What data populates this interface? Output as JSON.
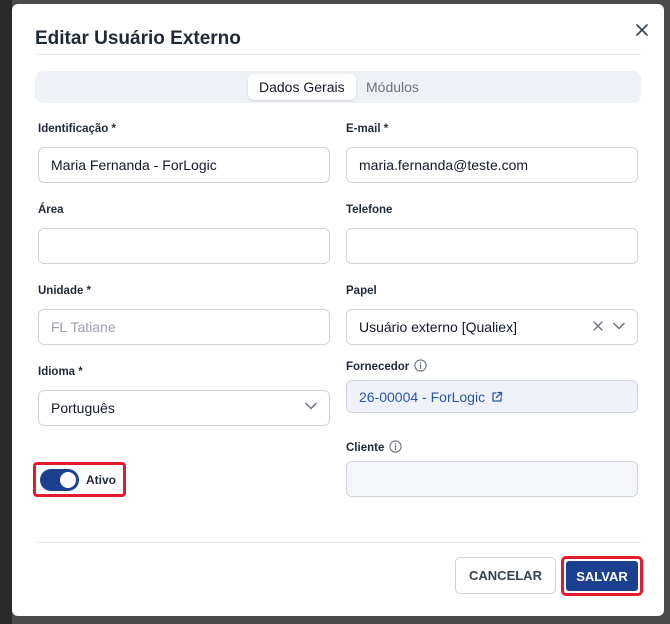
{
  "dialog": {
    "title": "Editar Usuário Externo"
  },
  "tabs": [
    {
      "label": "Dados Gerais",
      "active": true
    },
    {
      "label": "Módulos",
      "active": false
    }
  ],
  "form": {
    "identificacao": {
      "label": "Identificação *",
      "value": "Maria Fernanda - ForLogic"
    },
    "email": {
      "label": "E-mail *",
      "value": "maria.fernanda@teste.com"
    },
    "area": {
      "label": "Área",
      "value": ""
    },
    "telefone": {
      "label": "Telefone",
      "value": ""
    },
    "unidade": {
      "label": "Unidade *",
      "placeholder": "FL Tatiane"
    },
    "papel": {
      "label": "Papel",
      "value": "Usuário externo [Qualiex]"
    },
    "idioma": {
      "label": "Idioma *",
      "value": "Português"
    },
    "fornecedor": {
      "label": "Fornecedor",
      "value": "26-00004 - ForLogic"
    },
    "cliente": {
      "label": "Cliente",
      "value": ""
    },
    "status_toggle": {
      "label": "Ativo",
      "on": true
    }
  },
  "actions": {
    "cancel_label": "CANCELAR",
    "save_label": "SALVAR"
  },
  "colors": {
    "primary": "#1d3f8f",
    "highlight": "#e11d2b",
    "link": "#2955a3"
  },
  "icons": [
    "close-icon",
    "info-icon",
    "clear-icon",
    "chevron-down-icon",
    "external-link-icon"
  ]
}
